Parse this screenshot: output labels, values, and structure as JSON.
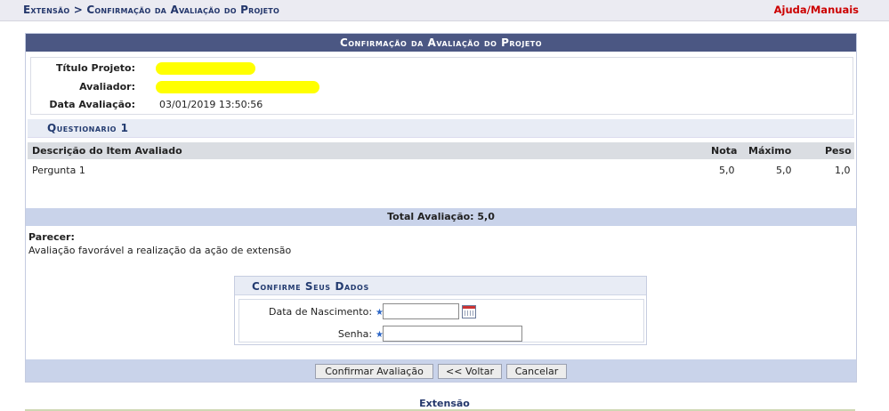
{
  "header": {
    "breadcrumb": "Extensão > Confirmação da Avaliação do Projeto",
    "help_link": "Ajuda/Manuais"
  },
  "panel": {
    "caption": "Confirmação da Avaliação do Projeto",
    "info": {
      "titulo_label": "Título Projeto:",
      "titulo_value": "",
      "avaliador_label": "Avaliador:",
      "avaliador_value": "",
      "data_label": "Data Avaliação:",
      "data_value": "03/01/2019 13:50:56"
    },
    "questionario": {
      "title": "Questionario 1",
      "columns": [
        "Descrição do Item Avaliado",
        "Nota",
        "Máximo",
        "Peso"
      ],
      "rows": [
        {
          "descricao": "Pergunta 1",
          "nota": "5,0",
          "maximo": "5,0",
          "peso": "1,0"
        }
      ]
    },
    "total": "Total Avaliação: 5,0",
    "parecer_label": "Parecer:",
    "parecer_text": "Avaliação favorável a realização da ação de extensão",
    "confirm": {
      "title": "Confirme Seus Dados",
      "nascimento_label": "Data de Nascimento:",
      "nascimento_value": "",
      "senha_label": "Senha:",
      "senha_value": ""
    },
    "buttons": {
      "confirmar": "Confirmar Avaliação",
      "voltar": "<< Voltar",
      "cancelar": "Cancelar"
    }
  },
  "footer": {
    "text": "Extensão"
  },
  "colors": {
    "header_bg": "#4b5783",
    "help": "#cc0000",
    "accent": "#23366b",
    "bar": "#c9d3ea"
  }
}
